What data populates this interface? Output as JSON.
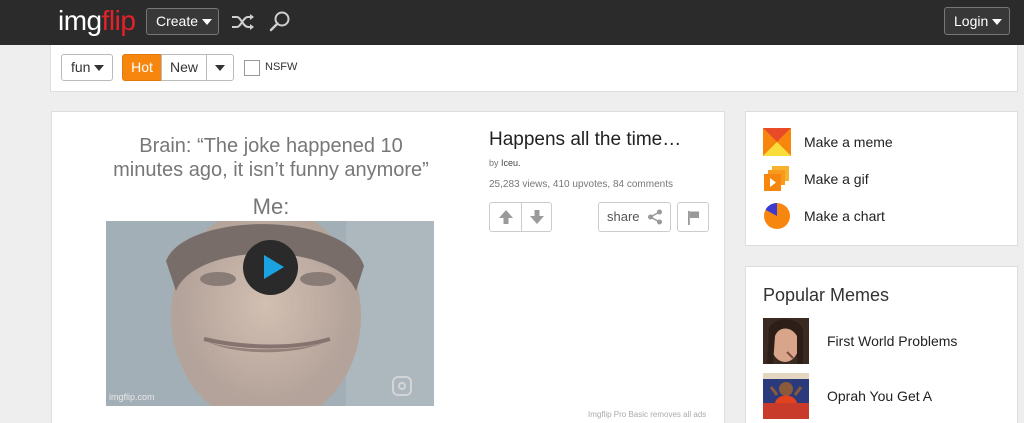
{
  "header": {
    "logo_part1": "img",
    "logo_part2": "flip",
    "create_label": "Create",
    "login_label": "Login"
  },
  "filters": {
    "category_label": "fun",
    "hot_label": "Hot",
    "new_label": "New",
    "nsfw_label": "NSFW"
  },
  "post": {
    "meme_caption": "Brain: “The joke happened 10 minutes ago, it isn’t funny anymore”",
    "meme_me": "Me:",
    "watermark": "imgflip.com",
    "title": "Happens all the time…",
    "by_prefix": "by",
    "author": "Iceu.",
    "stats": "25,283 views, 410 upvotes, 84 comments",
    "share_label": "share",
    "ads_note": "Imgflip Pro Basic removes all ads"
  },
  "sidebar": {
    "actions": [
      {
        "label": "Make a meme",
        "icon": "meme-maker-icon"
      },
      {
        "label": "Make a gif",
        "icon": "gif-maker-icon"
      },
      {
        "label": "Make a chart",
        "icon": "pie-chart-icon"
      }
    ],
    "popular_title": "Popular Memes",
    "popular": [
      {
        "label": "First World Problems"
      },
      {
        "label": "Oprah You Get A"
      }
    ]
  },
  "colors": {
    "accent": "#f7860e",
    "logo_red": "#e4212b",
    "header_bg": "#2b2b2b",
    "play_blue": "#1aa3e0"
  }
}
